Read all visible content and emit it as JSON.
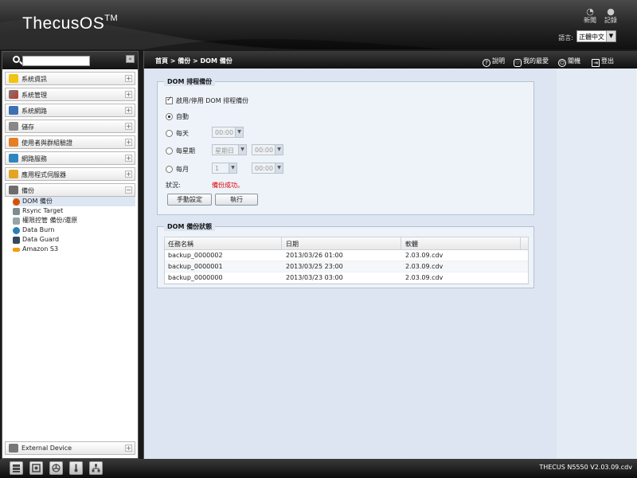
{
  "header": {
    "brand": "ThecusOS",
    "brand_tm": "TM",
    "news_label": "新聞",
    "log_label": "記錄",
    "language_label": "語言:",
    "language_value": "正體中文"
  },
  "sidebar": {
    "items": [
      {
        "label": "系統資訊"
      },
      {
        "label": "系統管理"
      },
      {
        "label": "系統網路"
      },
      {
        "label": "儲存"
      },
      {
        "label": "使用者與群組驗證"
      },
      {
        "label": "網路服務"
      },
      {
        "label": "應用程式伺服器"
      },
      {
        "label": "備份"
      }
    ],
    "backup_sub": [
      {
        "label": "DOM 備份"
      },
      {
        "label": "Rsync Target"
      },
      {
        "label": "權限控管 備份/還原"
      },
      {
        "label": "Data Burn"
      },
      {
        "label": "Data Guard"
      },
      {
        "label": "Amazon S3"
      }
    ],
    "external": "External Device",
    "expand_glyph": "+",
    "collapse_glyph": "−",
    "collapse_all": "«"
  },
  "topbar": {
    "breadcrumb": "首頁 > 備份 > DOM 備份",
    "help": "說明",
    "favorites": "我的最愛",
    "shutdown": "關機",
    "logout": "登出"
  },
  "schedule": {
    "legend": "DOM 排程備份",
    "enable_label": "啟用/停用 DOM 排程備份",
    "enabled": true,
    "auto_label": "自動",
    "daily_label": "每天",
    "daily_time": "00:00",
    "weekly_label": "每星期",
    "weekly_day": "星期日",
    "weekly_time": "00:00",
    "monthly_label": "每月",
    "monthly_day": "1",
    "monthly_time": "00:00",
    "selected": "auto",
    "status_label": "狀況:",
    "status_value": "備份成功。",
    "manual_button": "手動設定",
    "run_button": "執行"
  },
  "status_table": {
    "legend": "DOM 備份狀態",
    "columns": [
      "任務名稱",
      "日期",
      "軟體"
    ],
    "rows": [
      {
        "name": "backup_0000002",
        "date": "2013/03/26 01:00",
        "software": "2.03.09.cdv"
      },
      {
        "name": "backup_0000001",
        "date": "2013/03/25 23:00",
        "software": "2.03.09.cdv"
      },
      {
        "name": "backup_0000000",
        "date": "2013/03/23 03:00",
        "software": "2.03.09.cdv"
      }
    ]
  },
  "footer": {
    "version": "THECUS N5550 V2.03.09.cdv"
  }
}
